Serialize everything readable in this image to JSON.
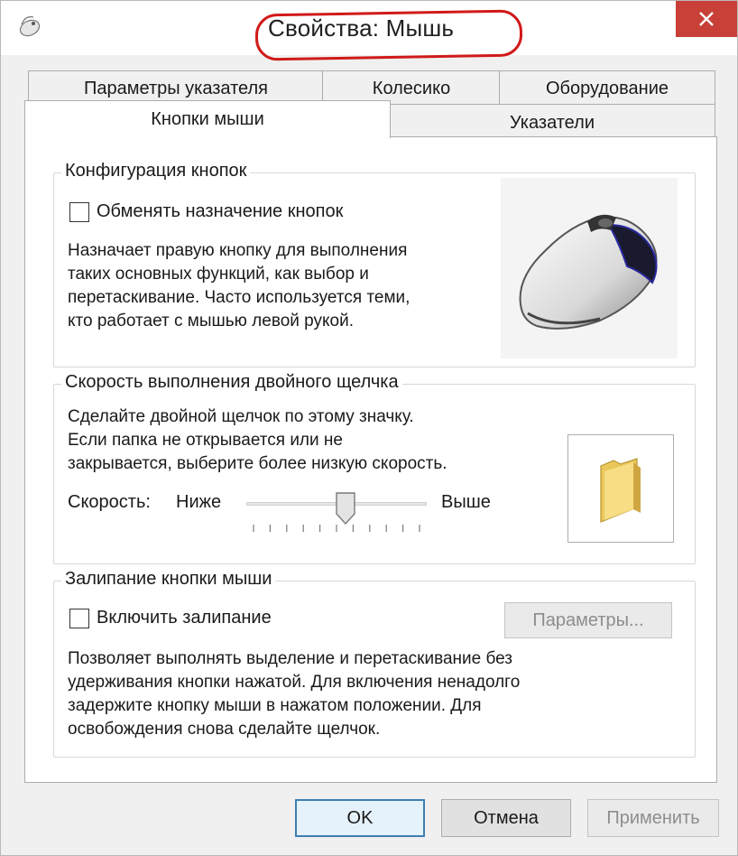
{
  "window": {
    "title": "Свойства: Мышь"
  },
  "tabs": {
    "row_back": [
      "Параметры указателя",
      "Колесико",
      "Оборудование"
    ],
    "row_front": [
      "Кнопки мыши",
      "Указатели"
    ],
    "active": "Кнопки мыши"
  },
  "button_config": {
    "legend": "Конфигурация кнопок",
    "swap_checkbox_label": "Обменять назначение кнопок",
    "swap_checked": false,
    "description_lines": [
      "Назначает правую кнопку для выполнения",
      "таких основных функций, как выбор и",
      "перетаскивание. Часто используется теми,",
      "кто работает с мышью левой рукой."
    ]
  },
  "double_click": {
    "legend": "Скорость выполнения двойного щелчка",
    "description_lines": [
      "Сделайте двойной щелчок по этому значку.",
      "Если папка не открывается или не",
      "закрывается, выберите более низкую скорость."
    ],
    "speed_label": "Скорость:",
    "slow_label": "Ниже",
    "fast_label": "Выше",
    "speed_position": 0.55,
    "tick_count": 11
  },
  "click_lock": {
    "legend": "Залипание кнопки мыши",
    "enable_label": "Включить залипание",
    "enable_checked": false,
    "settings_button": "Параметры...",
    "description_lines": [
      "Позволяет выполнять выделение и перетаскивание без",
      "удерживания кнопки нажатой. Для включения ненадолго",
      "задержите кнопку мыши в нажатом положении. Для",
      "освобождения снова сделайте щелчок."
    ]
  },
  "footer": {
    "ok": "OK",
    "cancel": "Отмена",
    "apply": "Применить"
  },
  "colors": {
    "highlight": "#d11a1a",
    "close_button": "#c84037",
    "default_button_border": "#3c7fb1"
  }
}
